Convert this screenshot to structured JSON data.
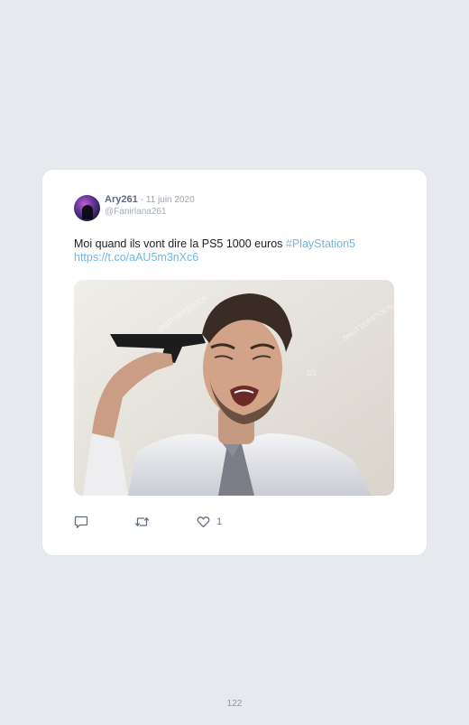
{
  "tweet": {
    "display_name": "Ary261",
    "date": "- 11 juin 2020",
    "handle": "@Fanirlana261",
    "text_main": "Moi quand ils vont dire la PS5 1000 euros ",
    "hashtag": "#PlayStation5",
    "link": "https://t.co/aAU5m3nXc6",
    "media": {
      "watermark_left": "SHUTTERSTOCK",
      "watermark_right": "SHUTTERSTOCK",
      "watermark_small": "SS"
    },
    "actions": {
      "reply_icon": "speech-bubble-icon",
      "retweet_icon": "retweet-icon",
      "like_icon": "heart-icon",
      "like_count": "1"
    }
  },
  "page": {
    "number": "122"
  },
  "colors": {
    "background": "#e6e9ee",
    "card": "#ffffff",
    "accent_link": "#6fb7e6",
    "name": "#5b6b84"
  }
}
